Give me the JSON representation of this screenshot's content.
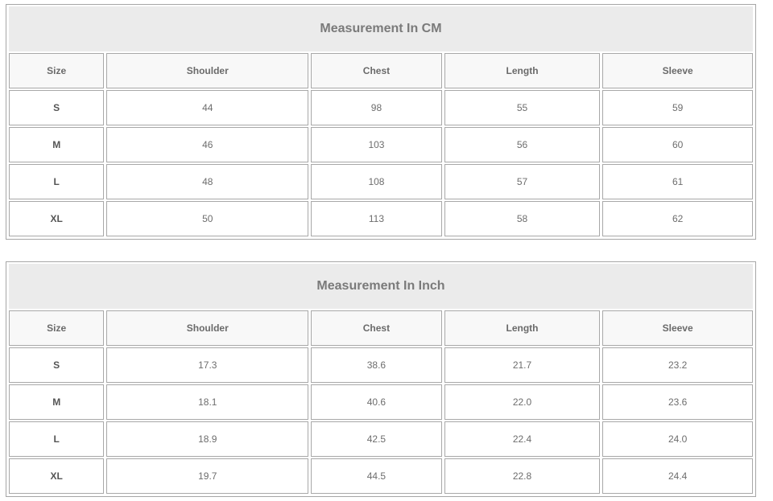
{
  "tables": [
    {
      "title": "Measurement In CM",
      "headers": [
        "Size",
        "Shoulder",
        "Chest",
        "Length",
        "Sleeve"
      ],
      "rows": [
        [
          "S",
          "44",
          "98",
          "55",
          "59"
        ],
        [
          "M",
          "46",
          "103",
          "56",
          "60"
        ],
        [
          "L",
          "48",
          "108",
          "57",
          "61"
        ],
        [
          "XL",
          "50",
          "113",
          "58",
          "62"
        ]
      ]
    },
    {
      "title": "Measurement In Inch",
      "headers": [
        "Size",
        "Shoulder",
        "Chest",
        "Length",
        "Sleeve"
      ],
      "rows": [
        [
          "S",
          "17.3",
          "38.6",
          "21.7",
          "23.2"
        ],
        [
          "M",
          "18.1",
          "40.6",
          "22.0",
          "23.6"
        ],
        [
          "L",
          "18.9",
          "42.5",
          "22.4",
          "24.0"
        ],
        [
          "XL",
          "19.7",
          "44.5",
          "22.8",
          "24.4"
        ]
      ]
    }
  ]
}
